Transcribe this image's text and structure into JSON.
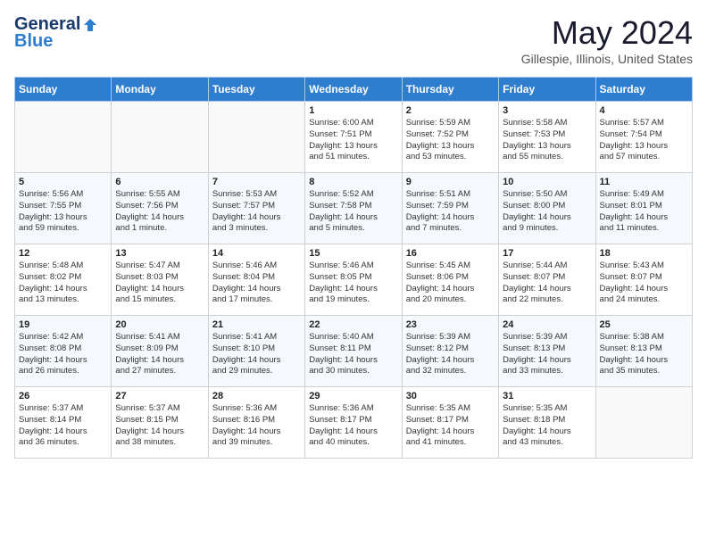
{
  "header": {
    "logo_general": "General",
    "logo_blue": "Blue",
    "title": "May 2024",
    "location": "Gillespie, Illinois, United States"
  },
  "weekdays": [
    "Sunday",
    "Monday",
    "Tuesday",
    "Wednesday",
    "Thursday",
    "Friday",
    "Saturday"
  ],
  "weeks": [
    [
      {
        "day": "",
        "info": ""
      },
      {
        "day": "",
        "info": ""
      },
      {
        "day": "",
        "info": ""
      },
      {
        "day": "1",
        "info": "Sunrise: 6:00 AM\nSunset: 7:51 PM\nDaylight: 13 hours\nand 51 minutes."
      },
      {
        "day": "2",
        "info": "Sunrise: 5:59 AM\nSunset: 7:52 PM\nDaylight: 13 hours\nand 53 minutes."
      },
      {
        "day": "3",
        "info": "Sunrise: 5:58 AM\nSunset: 7:53 PM\nDaylight: 13 hours\nand 55 minutes."
      },
      {
        "day": "4",
        "info": "Sunrise: 5:57 AM\nSunset: 7:54 PM\nDaylight: 13 hours\nand 57 minutes."
      }
    ],
    [
      {
        "day": "5",
        "info": "Sunrise: 5:56 AM\nSunset: 7:55 PM\nDaylight: 13 hours\nand 59 minutes."
      },
      {
        "day": "6",
        "info": "Sunrise: 5:55 AM\nSunset: 7:56 PM\nDaylight: 14 hours\nand 1 minute."
      },
      {
        "day": "7",
        "info": "Sunrise: 5:53 AM\nSunset: 7:57 PM\nDaylight: 14 hours\nand 3 minutes."
      },
      {
        "day": "8",
        "info": "Sunrise: 5:52 AM\nSunset: 7:58 PM\nDaylight: 14 hours\nand 5 minutes."
      },
      {
        "day": "9",
        "info": "Sunrise: 5:51 AM\nSunset: 7:59 PM\nDaylight: 14 hours\nand 7 minutes."
      },
      {
        "day": "10",
        "info": "Sunrise: 5:50 AM\nSunset: 8:00 PM\nDaylight: 14 hours\nand 9 minutes."
      },
      {
        "day": "11",
        "info": "Sunrise: 5:49 AM\nSunset: 8:01 PM\nDaylight: 14 hours\nand 11 minutes."
      }
    ],
    [
      {
        "day": "12",
        "info": "Sunrise: 5:48 AM\nSunset: 8:02 PM\nDaylight: 14 hours\nand 13 minutes."
      },
      {
        "day": "13",
        "info": "Sunrise: 5:47 AM\nSunset: 8:03 PM\nDaylight: 14 hours\nand 15 minutes."
      },
      {
        "day": "14",
        "info": "Sunrise: 5:46 AM\nSunset: 8:04 PM\nDaylight: 14 hours\nand 17 minutes."
      },
      {
        "day": "15",
        "info": "Sunrise: 5:46 AM\nSunset: 8:05 PM\nDaylight: 14 hours\nand 19 minutes."
      },
      {
        "day": "16",
        "info": "Sunrise: 5:45 AM\nSunset: 8:06 PM\nDaylight: 14 hours\nand 20 minutes."
      },
      {
        "day": "17",
        "info": "Sunrise: 5:44 AM\nSunset: 8:07 PM\nDaylight: 14 hours\nand 22 minutes."
      },
      {
        "day": "18",
        "info": "Sunrise: 5:43 AM\nSunset: 8:07 PM\nDaylight: 14 hours\nand 24 minutes."
      }
    ],
    [
      {
        "day": "19",
        "info": "Sunrise: 5:42 AM\nSunset: 8:08 PM\nDaylight: 14 hours\nand 26 minutes."
      },
      {
        "day": "20",
        "info": "Sunrise: 5:41 AM\nSunset: 8:09 PM\nDaylight: 14 hours\nand 27 minutes."
      },
      {
        "day": "21",
        "info": "Sunrise: 5:41 AM\nSunset: 8:10 PM\nDaylight: 14 hours\nand 29 minutes."
      },
      {
        "day": "22",
        "info": "Sunrise: 5:40 AM\nSunset: 8:11 PM\nDaylight: 14 hours\nand 30 minutes."
      },
      {
        "day": "23",
        "info": "Sunrise: 5:39 AM\nSunset: 8:12 PM\nDaylight: 14 hours\nand 32 minutes."
      },
      {
        "day": "24",
        "info": "Sunrise: 5:39 AM\nSunset: 8:13 PM\nDaylight: 14 hours\nand 33 minutes."
      },
      {
        "day": "25",
        "info": "Sunrise: 5:38 AM\nSunset: 8:13 PM\nDaylight: 14 hours\nand 35 minutes."
      }
    ],
    [
      {
        "day": "26",
        "info": "Sunrise: 5:37 AM\nSunset: 8:14 PM\nDaylight: 14 hours\nand 36 minutes."
      },
      {
        "day": "27",
        "info": "Sunrise: 5:37 AM\nSunset: 8:15 PM\nDaylight: 14 hours\nand 38 minutes."
      },
      {
        "day": "28",
        "info": "Sunrise: 5:36 AM\nSunset: 8:16 PM\nDaylight: 14 hours\nand 39 minutes."
      },
      {
        "day": "29",
        "info": "Sunrise: 5:36 AM\nSunset: 8:17 PM\nDaylight: 14 hours\nand 40 minutes."
      },
      {
        "day": "30",
        "info": "Sunrise: 5:35 AM\nSunset: 8:17 PM\nDaylight: 14 hours\nand 41 minutes."
      },
      {
        "day": "31",
        "info": "Sunrise: 5:35 AM\nSunset: 8:18 PM\nDaylight: 14 hours\nand 43 minutes."
      },
      {
        "day": "",
        "info": ""
      }
    ]
  ]
}
